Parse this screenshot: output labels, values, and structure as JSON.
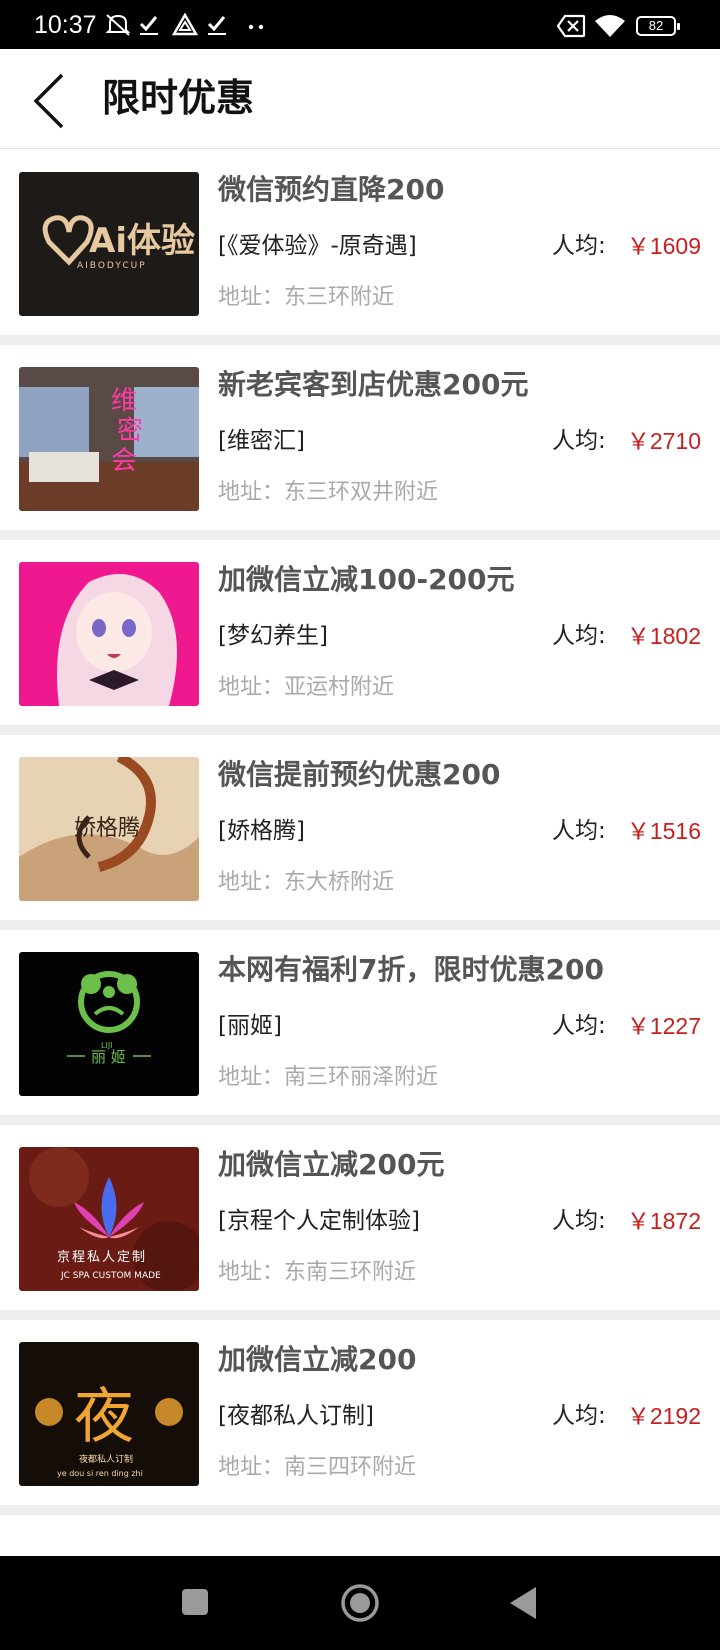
{
  "status_bar": {
    "time": "10:37",
    "battery": "82",
    "icons": [
      "mute-icon",
      "check-icon",
      "alert-triangle-icon",
      "check-icon",
      "more-dots-icon",
      "sim-off-icon",
      "wifi-icon",
      "battery-icon"
    ]
  },
  "header": {
    "title": "限时优惠",
    "back_icon": "chevron-left-icon"
  },
  "items": [
    {
      "title": "微信预约直降200",
      "shop": "[《爱体验》-原奇遇]",
      "avg_label": "人均:",
      "price": "￥1609",
      "address": "地址：东三环附近",
      "thumb": {
        "bg": "#1e1a17",
        "logo": "Ai体验",
        "sub": "AIBODYCUP",
        "color": "#e6c9a0"
      }
    },
    {
      "title": "新老宾客到店优惠200元",
      "shop": "[维密汇]",
      "avg_label": "人均:",
      "price": "￥2710",
      "address": "地址：东三环双井附近",
      "thumb": {
        "bg": "#5a4a46",
        "logo": "维密会",
        "color": "#ff3aa8"
      }
    },
    {
      "title": "加微信立减100-200元",
      "shop": "[梦幻养生]",
      "avg_label": "人均:",
      "price": "￥1802",
      "address": "地址：亚运村附近",
      "thumb": {
        "bg": "#f0188f",
        "color": "#f6d7e4"
      }
    },
    {
      "title": "微信提前预约优惠200",
      "shop": "[娇格腾]",
      "avg_label": "人均:",
      "price": "￥1516",
      "address": "地址：东大桥附近",
      "thumb": {
        "bg": "#e8d2b4",
        "logo": "娇格腾",
        "color": "#6a3a22"
      }
    },
    {
      "title": "本网有福利7折，限时优惠200",
      "shop": "[丽姬]",
      "avg_label": "人均:",
      "price": "￥1227",
      "address": "地址：南三环丽泽附近",
      "thumb": {
        "bg": "#030303",
        "logo": "丽 姬",
        "sub": "LIJI",
        "color": "#6cc04a"
      }
    },
    {
      "title": "加微信立减200元",
      "shop": "[京程个人定制体验]",
      "avg_label": "人均:",
      "price": "￥1872",
      "address": "地址：东南三环附近",
      "thumb": {
        "bg": "#6a1c14",
        "logo": "京程私人定制",
        "sub": "JC SPA CUSTOM MADE",
        "color": "#ffffff"
      }
    },
    {
      "title": "加微信立减200",
      "shop": "[夜都私人订制]",
      "avg_label": "人均:",
      "price": "￥2192",
      "address": "地址：南三四环附近",
      "thumb": {
        "bg": "#140d08",
        "logo": "夜",
        "sub": "夜都私人订制",
        "color": "#f2a632"
      }
    }
  ],
  "nav": {
    "buttons": [
      "recents-square-icon",
      "home-circle-icon",
      "back-triangle-icon"
    ]
  },
  "colors": {
    "price": "#c81e1e",
    "title": "#555555",
    "address": "#aaaaaa",
    "divider": "#eeeeee"
  }
}
